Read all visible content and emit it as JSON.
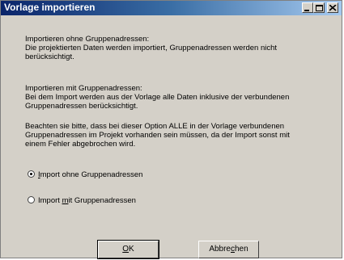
{
  "window": {
    "title": "Vorlage importieren",
    "controls": {
      "minimize": "minimize-icon",
      "maximize": "maximize-icon",
      "close": "close-icon"
    }
  },
  "content": {
    "section1_heading": "Importieren ohne Gruppenadressen:",
    "section1_text_line1": "Die projektierten Daten werden importiert, Gruppenadressen werden nicht",
    "section1_text_line2": "berücksichtigt.",
    "section2_heading": "Importieren mit Gruppenadressen:",
    "section2_text_line1": "Bei dem Import werden aus der Vorlage alle Daten inklusive der verbundenen",
    "section2_text_line2": "Gruppenadressen berücksichtigt.",
    "note_line1": "Beachten sie bitte, dass bei dieser Option ALLE in der Vorlage verbundenen",
    "note_line2": "Gruppenadressen im Projekt vorhanden sein müssen, da der Import sonst mit",
    "note_line3": "einem Fehler abgebrochen wird."
  },
  "options": {
    "option1": {
      "label_pre": "",
      "label_underline": "I",
      "label_post": "mport ohne Gruppenadressen",
      "selected": true
    },
    "option2": {
      "label_pre": "Import ",
      "label_underline": "m",
      "label_post": "it Gruppenadressen",
      "selected": false
    }
  },
  "buttons": {
    "ok": {
      "pre": "",
      "underline": "O",
      "post": "K"
    },
    "cancel": {
      "pre": "Abbre",
      "underline": "c",
      "post": "hen"
    }
  },
  "colors": {
    "titlebar_start": "#0a246a",
    "titlebar_end": "#a6caf0",
    "dialog_bg": "#d4d0c8"
  }
}
